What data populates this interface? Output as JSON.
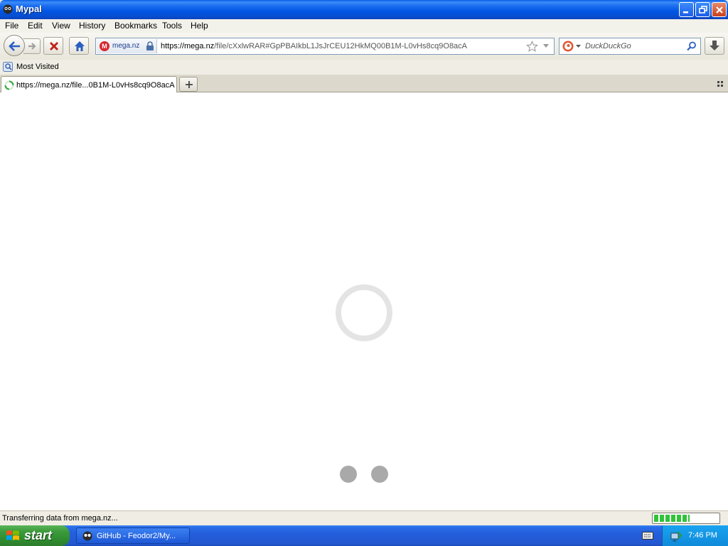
{
  "window": {
    "title": "Mypal"
  },
  "menu": [
    "File",
    "Edit",
    "View",
    "History",
    "Bookmarks",
    "Tools",
    "Help"
  ],
  "navbar": {
    "identity_site": "mega.nz",
    "url_host": "https://mega.nz",
    "url_path": "/file/cXxlwRAR#GpPBAIkbL1JsJrCEU12HkMQ00B1M-L0vHs8cq9O8acA",
    "search_placeholder": "DuckDuckGo"
  },
  "bookmarks": {
    "most_visited": "Most Visited"
  },
  "tabs": [
    {
      "label": "https://mega.nz/file...0B1M-L0vHs8cq9O8acA",
      "loading": true
    }
  ],
  "status": {
    "text": "Transferring data from mega.nz...",
    "progress": 0.55
  },
  "taskbar": {
    "start_label": "start",
    "items": [
      {
        "label": "GitHub - Feodor2/My..."
      }
    ],
    "clock": "7:46 PM"
  },
  "colors": {
    "title_blue": "#0054e3",
    "start_green": "#3c9a3c",
    "mega_red": "#d9272e",
    "progress_green": "#2fc33a"
  }
}
